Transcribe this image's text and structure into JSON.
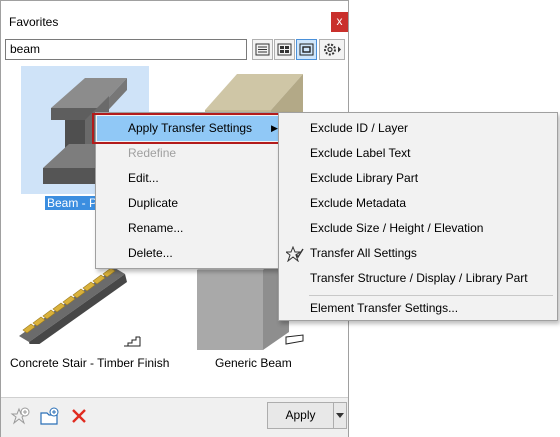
{
  "window": {
    "title": "Favorites",
    "close_glyph": "x"
  },
  "search": {
    "value": "beam"
  },
  "toolbar": {
    "view_buttons": [
      "list-view-icon",
      "grid-view-icon",
      "large-preview-icon"
    ],
    "settings_icon": "gear-icon"
  },
  "gallery": {
    "items": [
      {
        "caption": "Beam - Pr",
        "selected": true
      },
      {
        "caption": "",
        "selected": false
      },
      {
        "caption": "Concrete Stair - Timber Finish",
        "selected": false
      },
      {
        "caption": "Generic Beam",
        "selected": false
      }
    ]
  },
  "context_menu": {
    "items": [
      {
        "label": "Apply Transfer Settings",
        "highlighted": true,
        "submenu": true
      },
      {
        "label": "Redefine",
        "disabled": true
      },
      {
        "label": "Edit..."
      },
      {
        "label": "Duplicate"
      },
      {
        "label": "Rename..."
      },
      {
        "label": "Delete..."
      }
    ],
    "submenu_arrow": "▶"
  },
  "submenu": {
    "items": [
      {
        "label": "Exclude ID / Layer"
      },
      {
        "label": "Exclude Label Text"
      },
      {
        "label": "Exclude Library Part"
      },
      {
        "label": "Exclude Metadata"
      },
      {
        "label": "Exclude Size / Height / Elevation"
      },
      {
        "label": "Transfer All Settings",
        "checked": true
      },
      {
        "label": "Transfer Structure / Display / Library Part"
      },
      {
        "label": "Element Transfer Settings..."
      }
    ]
  },
  "bottom": {
    "apply_label": "Apply",
    "icons": [
      "add-favorite-icon",
      "new-folder-icon",
      "delete-icon"
    ]
  },
  "colors": {
    "close_bg": "#c9302c",
    "highlight": "#90c8f6",
    "selection": "#3b8ee0",
    "callout_border": "#b31b1b",
    "delete_icon": "#e02b20"
  }
}
